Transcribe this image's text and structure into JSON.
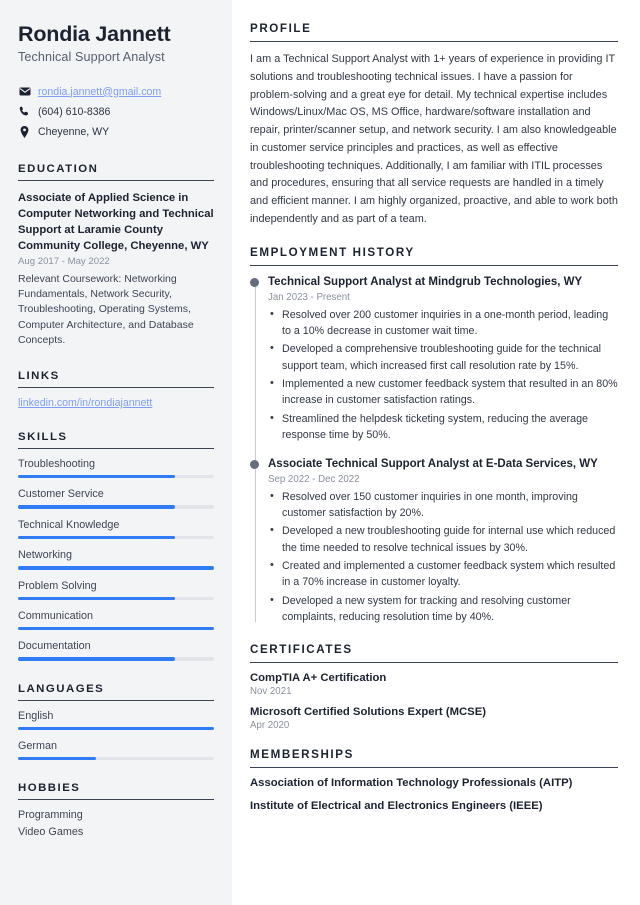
{
  "theme": {
    "sidebar_bg": "#f3f4f6",
    "accent": "#2f7cf6",
    "heading": "#1c2230",
    "link": "#7d9ef2",
    "muted": "#8a90a0",
    "dot": "#656d7e"
  },
  "header": {
    "name": "Rondia Jannett",
    "title": "Technical Support Analyst",
    "contacts": [
      {
        "icon": "envelope-icon",
        "text": "rondia.jannett@gmail.com",
        "is_link": true
      },
      {
        "icon": "phone-icon",
        "text": "(604) 610-8386",
        "is_link": false
      },
      {
        "icon": "location-pin-icon",
        "text": "Cheyenne, WY",
        "is_link": false
      }
    ]
  },
  "sidebar": {
    "education": {
      "heading": "Education",
      "items": [
        {
          "degree": "Associate of Applied Science in Computer Networking and Technical Support at Laramie County Community College, Cheyenne, WY",
          "date": "Aug 2017 - May 2022",
          "description": "Relevant Coursework: Networking Fundamentals, Network Security, Troubleshooting, Operating Systems, Computer Architecture, and Database Concepts."
        }
      ]
    },
    "links": {
      "heading": "Links",
      "items": [
        {
          "label": "linkedin.com/in/rondiajannett"
        }
      ]
    },
    "skills": {
      "heading": "Skills",
      "items": [
        {
          "label": "Troubleshooting",
          "level": 80
        },
        {
          "label": "Customer Service",
          "level": 80
        },
        {
          "label": "Technical Knowledge",
          "level": 80
        },
        {
          "label": "Networking",
          "level": 100
        },
        {
          "label": "Problem Solving",
          "level": 80
        },
        {
          "label": "Communication",
          "level": 100
        },
        {
          "label": "Documentation",
          "level": 80
        }
      ]
    },
    "languages": {
      "heading": "Languages",
      "items": [
        {
          "label": "English",
          "level": 100
        },
        {
          "label": "German",
          "level": 40
        }
      ]
    },
    "hobbies": {
      "heading": "Hobbies",
      "items": [
        {
          "label": "Programming"
        },
        {
          "label": "Video Games"
        }
      ]
    }
  },
  "main": {
    "profile": {
      "heading": "Profile",
      "text": "I am a Technical Support Analyst with 1+ years of experience in providing IT solutions and troubleshooting technical issues. I have a passion for problem-solving and a great eye for detail. My technical expertise includes Windows/Linux/Mac OS, MS Office, hardware/software installation and repair, printer/scanner setup, and network security. I am also knowledgeable in customer service principles and practices, as well as effective troubleshooting techniques. Additionally, I am familiar with ITIL processes and procedures, ensuring that all service requests are handled in a timely and efficient manner. I am highly organized, proactive, and able to work both independently and as part of a team."
    },
    "employment": {
      "heading": "Employment History",
      "jobs": [
        {
          "title": "Technical Support Analyst at Mindgrub Technologies, WY",
          "date": "Jan 2023 - Present",
          "bullets": [
            "Resolved over 200 customer inquiries in a one-month period, leading to a 10% decrease in customer wait time.",
            "Developed a comprehensive troubleshooting guide for the technical support team, which increased first call resolution rate by 15%.",
            "Implemented a new customer feedback system that resulted in an 80% increase in customer satisfaction ratings.",
            "Streamlined the helpdesk ticketing system, reducing the average response time by 50%."
          ]
        },
        {
          "title": "Associate Technical Support Analyst at E-Data Services, WY",
          "date": "Sep 2022 - Dec 2022",
          "bullets": [
            "Resolved over 150 customer inquiries in one month, improving customer satisfaction by 20%.",
            "Developed a new troubleshooting guide for internal use which reduced the time needed to resolve technical issues by 30%.",
            "Created and implemented a customer feedback system which resulted in a 70% increase in customer loyalty.",
            "Developed a new system for tracking and resolving customer complaints, reducing resolution time by 40%."
          ]
        }
      ]
    },
    "certificates": {
      "heading": "Certificates",
      "items": [
        {
          "name": "CompTIA A+ Certification",
          "date": "Nov 2021"
        },
        {
          "name": "Microsoft Certified Solutions Expert (MCSE)",
          "date": "Apr 2020"
        }
      ]
    },
    "memberships": {
      "heading": "Memberships",
      "items": [
        {
          "name": "Association of Information Technology Professionals (AITP)"
        },
        {
          "name": "Institute of Electrical and Electronics Engineers (IEEE)"
        }
      ]
    }
  }
}
